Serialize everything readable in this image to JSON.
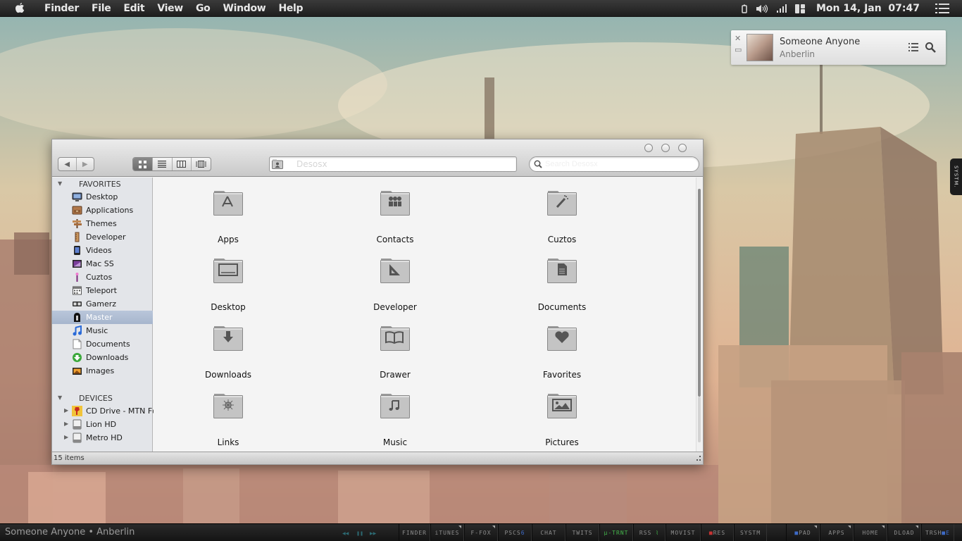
{
  "menubar": {
    "app_icon": "apple-icon",
    "items": [
      "Finder",
      "File",
      "Edit",
      "View",
      "Go",
      "Window",
      "Help"
    ],
    "status_icons": [
      "battery-icon",
      "volume-icon",
      "signal-icon",
      "window-layout-icon"
    ],
    "clock": "Mon 14, Jan  07:47",
    "menu_icon": "list-menu-icon"
  },
  "now_playing_widget": {
    "close_icon": "close-icon",
    "minimize_icon": "minimize-icon",
    "title": "Someone Anyone",
    "artist": "Anberlin",
    "playlist_icon": "playlist-icon",
    "search_icon": "search-icon"
  },
  "side_tab": {
    "label": "SYSTM."
  },
  "finder": {
    "toolbar": {
      "back_icon": "back-arrow-icon",
      "forward_icon": "forward-arrow-icon",
      "view_modes": [
        "icon-view",
        "list-view",
        "column-view",
        "coverflow-view"
      ],
      "active_view": "icon-view",
      "path_value": "Desosx",
      "search_placeholder": "Search Desosx"
    },
    "sidebar": {
      "favorites_header": "FAVORITES",
      "favorites": [
        {
          "label": "Desktop",
          "icon": "monitor-icon"
        },
        {
          "label": "Applications",
          "icon": "applications-icon"
        },
        {
          "label": "Themes",
          "icon": "signpost-icon"
        },
        {
          "label": "Developer",
          "icon": "ruler-icon"
        },
        {
          "label": "Videos",
          "icon": "video-icon"
        },
        {
          "label": "Mac SS",
          "icon": "screenshot-icon"
        },
        {
          "label": "Cuztos",
          "icon": "wand-icon"
        },
        {
          "label": "Teleport",
          "icon": "calendar-icon"
        },
        {
          "label": "Gamerz",
          "icon": "gamepad-icon"
        },
        {
          "label": "Master",
          "icon": "master-icon",
          "selected": true
        },
        {
          "label": "Music",
          "icon": "music-note-icon"
        },
        {
          "label": "Documents",
          "icon": "document-icon"
        },
        {
          "label": "Downloads",
          "icon": "download-icon"
        },
        {
          "label": "Images",
          "icon": "image-icon"
        }
      ],
      "devices_header": "DEVICES",
      "devices": [
        {
          "label": "CD Drive - MTN F@",
          "icon": "cd-drive-icon"
        },
        {
          "label": "Lion HD",
          "icon": "hard-drive-icon"
        },
        {
          "label": "Metro HD",
          "icon": "hard-drive-icon"
        }
      ]
    },
    "items": [
      {
        "label": "Apps",
        "glyph": "apps"
      },
      {
        "label": "Contacts",
        "glyph": "contacts"
      },
      {
        "label": "Cuztos",
        "glyph": "wand"
      },
      {
        "label": "Desktop",
        "glyph": "desktop"
      },
      {
        "label": "Developer",
        "glyph": "developer"
      },
      {
        "label": "Documents",
        "glyph": "documents"
      },
      {
        "label": "Downloads",
        "glyph": "downloads"
      },
      {
        "label": "Drawer",
        "glyph": "book"
      },
      {
        "label": "Favorites",
        "glyph": "heart"
      },
      {
        "label": "Links",
        "glyph": "compass"
      },
      {
        "label": "Music",
        "glyph": "music"
      },
      {
        "label": "Pictures",
        "glyph": "pictures"
      }
    ],
    "status": "15 items"
  },
  "dock": {
    "now_playing": "Someone Anyone • Anberlin",
    "controls": [
      "previous-icon",
      "pause-icon",
      "next-icon"
    ],
    "buttons": [
      {
        "label": "FINDER"
      },
      {
        "label": "iTUNES"
      },
      {
        "label": "F-FOX"
      },
      {
        "label": "PSCS",
        "accent": "6"
      },
      {
        "label": "CHAT"
      },
      {
        "label": "TWITS"
      },
      {
        "label": "µ-TRNT"
      },
      {
        "label": "RSS"
      },
      {
        "label": "MOVIST"
      },
      {
        "label": "RES"
      },
      {
        "label": "SYSTM"
      },
      {
        "label": "PAD"
      },
      {
        "label": "APPS"
      },
      {
        "label": "HOME"
      },
      {
        "label": "DLOAD"
      },
      {
        "label": "TRSH",
        "accent": "E"
      }
    ]
  },
  "colors": {
    "menubar": "#252525",
    "selection": "#aebbd0",
    "dock_blue": "#3d6ac7",
    "dock_green": "#43b54a",
    "dock_red": "#c53333"
  }
}
